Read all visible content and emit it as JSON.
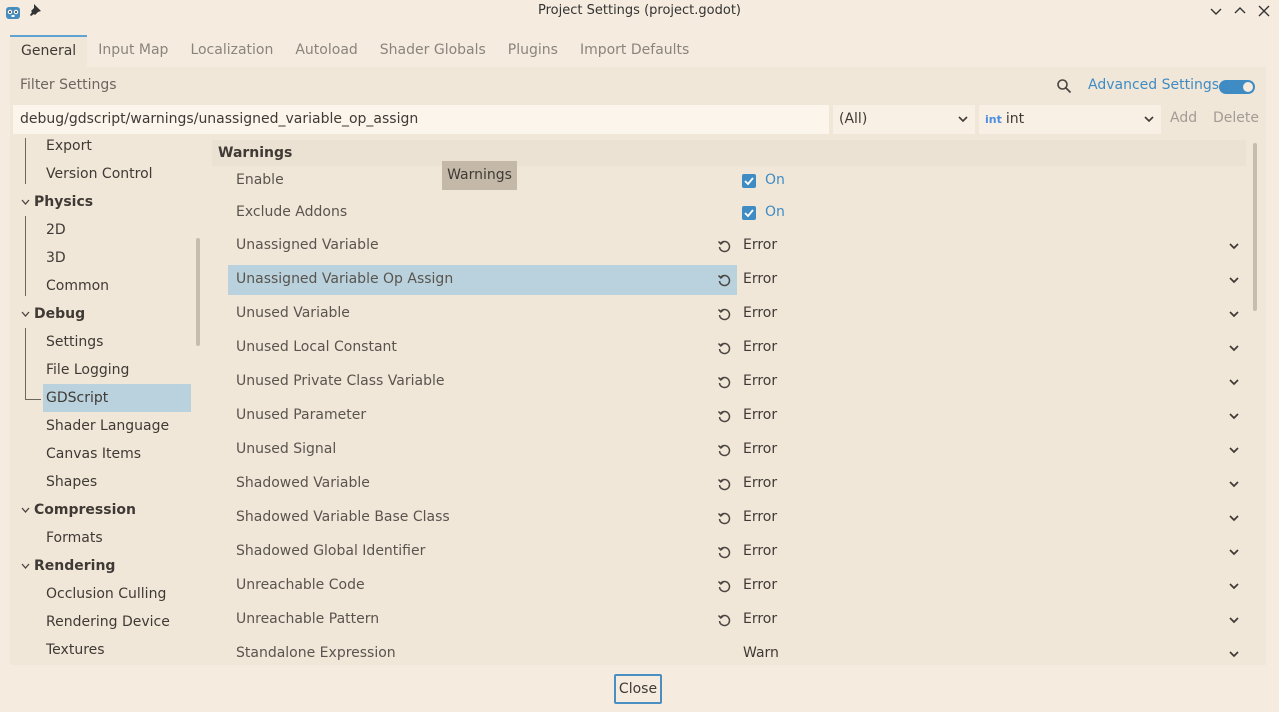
{
  "window": {
    "title": "Project Settings (project.godot)"
  },
  "tabs": [
    {
      "label": "General",
      "active": true
    },
    {
      "label": "Input Map"
    },
    {
      "label": "Localization"
    },
    {
      "label": "Autoload"
    },
    {
      "label": "Shader Globals"
    },
    {
      "label": "Plugins"
    },
    {
      "label": "Import Defaults"
    }
  ],
  "filter": {
    "placeholder": "Filter Settings"
  },
  "advanced": {
    "label": "Advanced Settings",
    "enabled": true
  },
  "property_path": {
    "value": "debug/gdscript/warnings/unassigned_variable_op_assign"
  },
  "feature_select": {
    "value": "(All)"
  },
  "type_select": {
    "badge": "int",
    "value": "int"
  },
  "actions": {
    "add": "Add",
    "delete": "Delete"
  },
  "tree": [
    {
      "label": "Export",
      "type": "child"
    },
    {
      "label": "Version Control",
      "type": "child"
    },
    {
      "label": "Physics",
      "type": "section"
    },
    {
      "label": "2D",
      "type": "child"
    },
    {
      "label": "3D",
      "type": "child"
    },
    {
      "label": "Common",
      "type": "child"
    },
    {
      "label": "Debug",
      "type": "section"
    },
    {
      "label": "Settings",
      "type": "child"
    },
    {
      "label": "File Logging",
      "type": "child"
    },
    {
      "label": "GDScript",
      "type": "child",
      "selected": true
    },
    {
      "label": "Shader Language",
      "type": "child"
    },
    {
      "label": "Canvas Items",
      "type": "child"
    },
    {
      "label": "Shapes",
      "type": "child"
    },
    {
      "label": "Compression",
      "type": "section"
    },
    {
      "label": "Formats",
      "type": "child"
    },
    {
      "label": "Rendering",
      "type": "section"
    },
    {
      "label": "Occlusion Culling",
      "type": "child"
    },
    {
      "label": "Rendering Device",
      "type": "child"
    },
    {
      "label": "Textures",
      "type": "child"
    }
  ],
  "inspector": {
    "section": "Warnings",
    "tooltip": "Warnings",
    "properties": [
      {
        "label": "Enable",
        "kind": "check",
        "value": "On"
      },
      {
        "label": "Exclude Addons",
        "kind": "check",
        "value": "On"
      },
      {
        "label": "Unassigned Variable",
        "kind": "enum",
        "value": "Error",
        "revert": true
      },
      {
        "label": "Unassigned Variable Op Assign",
        "kind": "enum",
        "value": "Error",
        "revert": true,
        "highlighted": true
      },
      {
        "label": "Unused Variable",
        "kind": "enum",
        "value": "Error",
        "revert": true
      },
      {
        "label": "Unused Local Constant",
        "kind": "enum",
        "value": "Error",
        "revert": true
      },
      {
        "label": "Unused Private Class Variable",
        "kind": "enum",
        "value": "Error",
        "revert": true
      },
      {
        "label": "Unused Parameter",
        "kind": "enum",
        "value": "Error",
        "revert": true
      },
      {
        "label": "Unused Signal",
        "kind": "enum",
        "value": "Error",
        "revert": true
      },
      {
        "label": "Shadowed Variable",
        "kind": "enum",
        "value": "Error",
        "revert": true
      },
      {
        "label": "Shadowed Variable Base Class",
        "kind": "enum",
        "value": "Error",
        "revert": true
      },
      {
        "label": "Shadowed Global Identifier",
        "kind": "enum",
        "value": "Error",
        "revert": true
      },
      {
        "label": "Unreachable Code",
        "kind": "enum",
        "value": "Error",
        "revert": true
      },
      {
        "label": "Unreachable Pattern",
        "kind": "enum",
        "value": "Error",
        "revert": true
      },
      {
        "label": "Standalone Expression",
        "kind": "enum",
        "value": "Warn",
        "revert": false
      }
    ]
  },
  "footer": {
    "close": "Close"
  },
  "colors": {
    "accent": "#3f8cc4",
    "selection": "#b9d2dd",
    "background": "#f5ecdf"
  }
}
